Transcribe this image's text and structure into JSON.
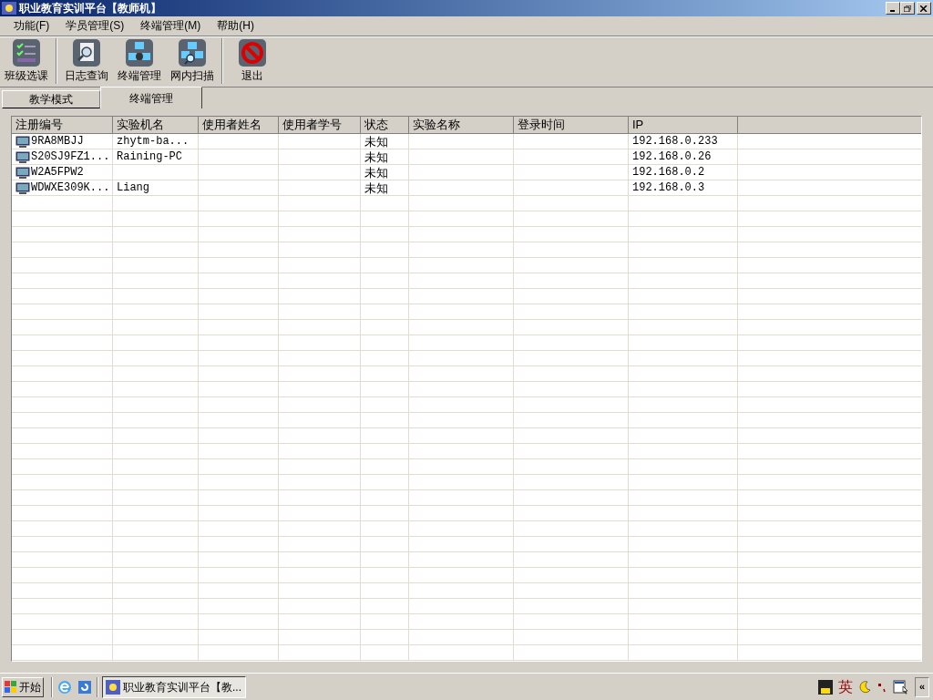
{
  "window": {
    "title": "职业教育实训平台【教师机】"
  },
  "menu": [
    "功能(F)",
    "学员管理(S)",
    "终端管理(M)",
    "帮助(H)"
  ],
  "toolbar": [
    {
      "label": "班级选课",
      "kind": "checklist"
    },
    {
      "label": "日志查询",
      "kind": "log"
    },
    {
      "label": "终端管理",
      "kind": "terminal"
    },
    {
      "label": "网内扫描",
      "kind": "scan"
    },
    {
      "label": "退出",
      "kind": "exit"
    }
  ],
  "tabs": [
    {
      "label": "教学模式",
      "selected": false
    },
    {
      "label": "终端管理",
      "selected": true
    }
  ],
  "table": {
    "columns": [
      "注册编号",
      "实验机名",
      "使用者姓名",
      "使用者学号",
      "状态",
      "实验名称",
      "登录时间",
      "IP"
    ],
    "rows": [
      {
        "cells": [
          "9RA8MBJJ",
          "zhytm-ba...",
          null,
          null,
          "未知",
          null,
          null,
          "192.168.0.233"
        ]
      },
      {
        "cells": [
          "S20SJ9FZ1...",
          "Raining-PC",
          null,
          null,
          "未知",
          null,
          null,
          "192.168.0.26"
        ]
      },
      {
        "cells": [
          "W2A5FPW2",
          null,
          null,
          null,
          "未知",
          null,
          null,
          "192.168.0.2"
        ]
      },
      {
        "cells": [
          "WDWXE309K...",
          "Liang",
          null,
          null,
          "未知",
          null,
          null,
          "192.168.0.3"
        ]
      }
    ]
  },
  "taskbar": {
    "start": "开始",
    "task": "职业教育实训平台【教...",
    "ime": "英",
    "expand": "«"
  }
}
